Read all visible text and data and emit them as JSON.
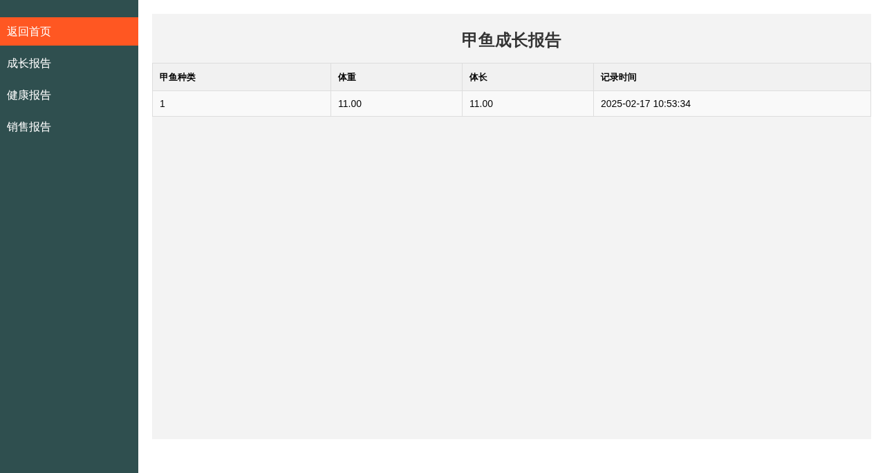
{
  "sidebar": {
    "items": [
      {
        "label": "返回首页",
        "selected": true
      },
      {
        "label": "成长报告",
        "selected": false
      },
      {
        "label": "健康报告",
        "selected": false
      },
      {
        "label": "销售报告",
        "selected": false
      }
    ]
  },
  "report": {
    "title": "甲鱼成长报告",
    "table": {
      "columns": [
        "甲鱼种类",
        "体重",
        "体长",
        "记录时间"
      ],
      "rows": [
        [
          "1",
          "11.00",
          "11.00",
          "2025-02-17 10:53:34"
        ]
      ]
    }
  }
}
